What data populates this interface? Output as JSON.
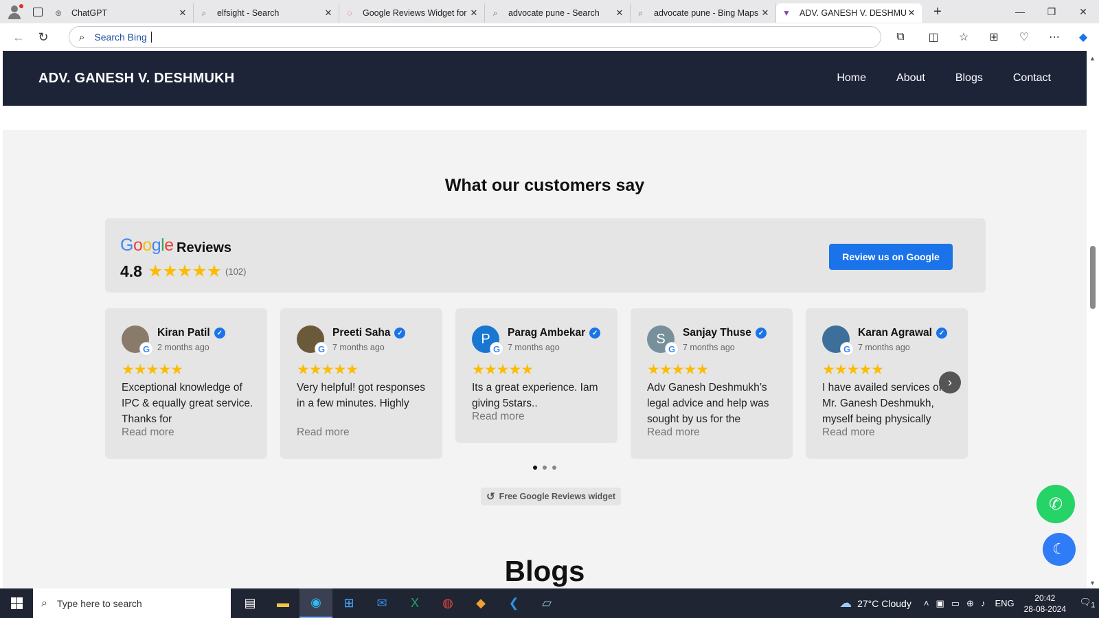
{
  "browser": {
    "tabs": [
      {
        "title": "ChatGPT",
        "icon": "chatgpt-icon",
        "active": false
      },
      {
        "title": "elfsight - Search",
        "icon": "search-icon",
        "active": false
      },
      {
        "title": "Google Reviews Widget for y",
        "icon": "elfsight-icon",
        "active": false
      },
      {
        "title": "advocate pune - Search",
        "icon": "search-icon",
        "active": false
      },
      {
        "title": "advocate pune - Bing Maps",
        "icon": "search-icon",
        "active": false
      },
      {
        "title": "ADV. GANESH V. DESHMUKH",
        "icon": "site-favicon",
        "active": true
      }
    ],
    "address_placeholder": "Search Bing"
  },
  "site": {
    "brand": "ADV. GANESH V. DESHMUKH",
    "nav": [
      "Home",
      "About",
      "Blogs",
      "Contact"
    ]
  },
  "reviews_section": {
    "title": "What our customers say",
    "provider_logo": "Google",
    "label": "Reviews",
    "rating": "4.8",
    "count": "(102)",
    "review_button": "Review us on Google",
    "read_more": "Read more",
    "reviews": [
      {
        "name": "Kiran Patil",
        "date": "2 months ago",
        "stars": 5,
        "text": "Exceptional knowledge of IPC & equally great service. Thanks for",
        "avatar": "photo",
        "avatar_color": "#8a7a6a"
      },
      {
        "name": "Preeti Saha",
        "date": "7 months ago",
        "stars": 5,
        "text": "Very helpful! got responses in a few minutes. Highly",
        "avatar": "photo",
        "avatar_color": "#6b5a3a"
      },
      {
        "name": "Parag Ambekar",
        "date": "7 months ago",
        "stars": 5,
        "text": "Its a great experience. Iam giving 5stars..",
        "avatar": "P",
        "avatar_color": "#1976d2"
      },
      {
        "name": "Sanjay Thuse",
        "date": "7 months ago",
        "stars": 5,
        "text": "Adv Ganesh Deshmukh’s legal advice and help was sought by us for the",
        "avatar": "S",
        "avatar_color": "#78909c"
      },
      {
        "name": "Karan Agrawal",
        "date": "7 months ago",
        "stars": 5,
        "text": "I have availed services of Mr. Ganesh Deshmukh, myself being physically",
        "avatar": "photo",
        "avatar_color": "#3d6f9a"
      }
    ],
    "pagination": {
      "pages": 3,
      "current": 1
    },
    "widget_badge": "Free Google Reviews widget"
  },
  "next_section_title": "Blogs",
  "taskbar": {
    "search_placeholder": "Type here to search",
    "weather": "27°C  Cloudy",
    "language": "ENG",
    "time": "20:42",
    "date": "28-08-2024",
    "notification_count": "1"
  }
}
